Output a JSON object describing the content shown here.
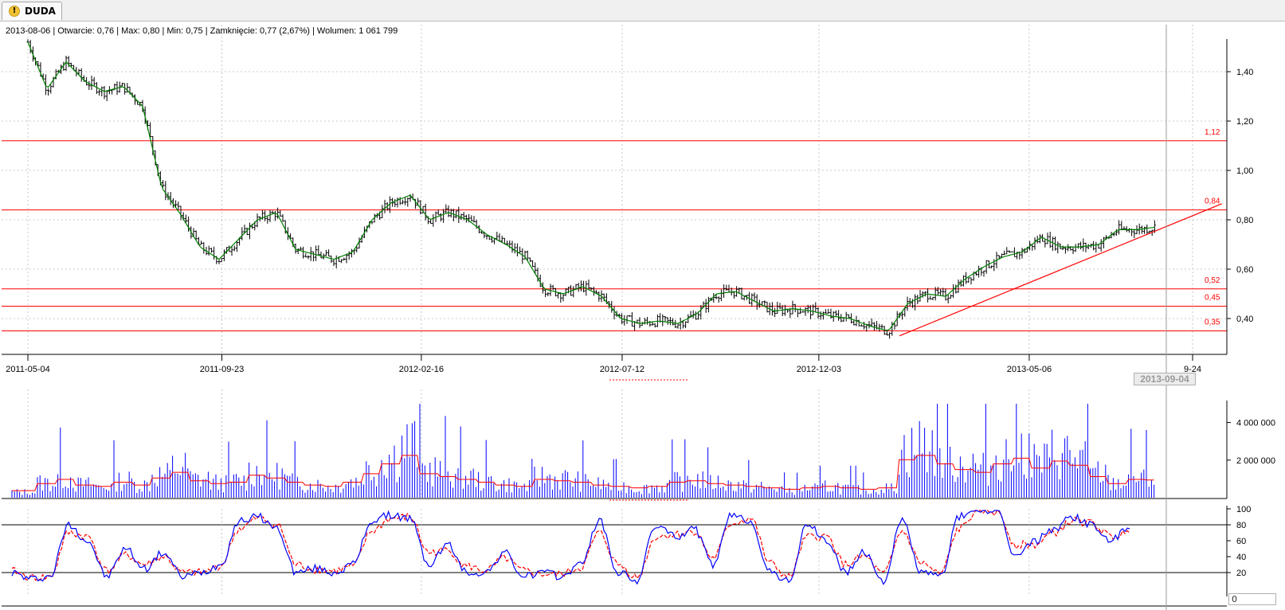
{
  "tab": {
    "label": "DUDA",
    "icon": "warning-icon"
  },
  "header": {
    "ohlc": "2013-08-06 | Otwarcie: 0,76 | Max: 0,80 | Min: 0,75 | Zamknięcie: 0,77 (2,67%) | Wolumen: 1 061 799"
  },
  "cursor_date": "2013-09-04",
  "corner_value": "0",
  "colors": {
    "bar": "#000000",
    "ma": "#008000",
    "level": "#ff0000",
    "volume": "#0000ff",
    "volume_ma": "#ff0000",
    "stoch_k": "#0000ff",
    "stoch_d": "#ff0000",
    "grid": "#c8c8c8"
  },
  "chart_data": [
    {
      "type": "line",
      "name": "price",
      "x_ticks": [
        "2011-05-04",
        "2011-09-23",
        "2012-02-16",
        "2012-07-12",
        "2012-12-03",
        "2013-05-06",
        "9-24"
      ],
      "y_ticks": [
        "1,40",
        "1,20",
        "1,00",
        "0,80",
        "0,60",
        "0,40"
      ],
      "ylim": [
        0.32,
        1.56
      ],
      "horizontal_levels": [
        {
          "value": 1.12,
          "label": "1,12"
        },
        {
          "value": 0.84,
          "label": "0,84"
        },
        {
          "value": 0.52,
          "label": "0,52"
        },
        {
          "value": 0.45,
          "label": "0,45"
        },
        {
          "value": 0.35,
          "label": "0,35"
        }
      ],
      "trendline": {
        "from": [
          "2013-01-31",
          0.33
        ],
        "to": [
          "2013-09-24",
          0.865
        ]
      },
      "x": [
        "2011-05-04",
        "2011-05-18",
        "2011-06-01",
        "2011-06-15",
        "2011-06-29",
        "2011-07-13",
        "2011-07-27",
        "2011-08-10",
        "2011-08-24",
        "2011-09-07",
        "2011-09-21",
        "2011-10-05",
        "2011-10-19",
        "2011-11-02",
        "2011-11-16",
        "2011-11-30",
        "2011-12-14",
        "2011-12-28",
        "2012-01-11",
        "2012-01-25",
        "2012-02-08",
        "2012-02-22",
        "2012-03-07",
        "2012-03-21",
        "2012-04-04",
        "2012-04-18",
        "2012-05-02",
        "2012-05-16",
        "2012-05-30",
        "2012-06-13",
        "2012-06-27",
        "2012-07-11",
        "2012-07-25",
        "2012-08-08",
        "2012-08-22",
        "2012-09-05",
        "2012-09-19",
        "2012-10-03",
        "2012-10-17",
        "2012-10-31",
        "2012-11-14",
        "2012-11-28",
        "2012-12-12",
        "2012-12-26",
        "2013-01-09",
        "2013-01-23",
        "2013-02-06",
        "2013-02-20",
        "2013-03-06",
        "2013-03-20",
        "2013-04-03",
        "2013-04-17",
        "2013-05-01",
        "2013-05-15",
        "2013-05-29",
        "2013-06-12",
        "2013-06-26",
        "2013-07-10",
        "2013-07-24",
        "2013-08-06"
      ],
      "close": [
        1.52,
        1.33,
        1.44,
        1.36,
        1.32,
        1.34,
        1.26,
        0.93,
        0.82,
        0.69,
        0.64,
        0.72,
        0.8,
        0.83,
        0.68,
        0.66,
        0.64,
        0.67,
        0.8,
        0.87,
        0.9,
        0.8,
        0.83,
        0.8,
        0.74,
        0.7,
        0.65,
        0.52,
        0.5,
        0.53,
        0.49,
        0.4,
        0.38,
        0.39,
        0.38,
        0.42,
        0.5,
        0.51,
        0.47,
        0.43,
        0.44,
        0.43,
        0.41,
        0.4,
        0.37,
        0.35,
        0.46,
        0.5,
        0.49,
        0.56,
        0.61,
        0.65,
        0.67,
        0.73,
        0.69,
        0.69,
        0.7,
        0.76,
        0.76,
        0.77
      ]
    },
    {
      "type": "bar",
      "name": "Wolumen",
      "y_ticks": [
        "4 000 000",
        "2 000 000"
      ],
      "ylim": [
        0,
        5000000
      ],
      "values": [
        300000,
        800000,
        1100000,
        700000,
        600000,
        900000,
        700000,
        1200000,
        1600000,
        1000000,
        800000,
        900000,
        1400000,
        1200000,
        900000,
        700000,
        600000,
        900000,
        1500000,
        2200000,
        2800000,
        1500000,
        1300000,
        1100000,
        900000,
        700000,
        600000,
        1100000,
        1000000,
        900000,
        700000,
        600000,
        500000,
        600000,
        900000,
        1000000,
        800000,
        700000,
        600000,
        500000,
        400000,
        500000,
        600000,
        500000,
        400000,
        500000,
        2500000,
        2800000,
        2200000,
        1800000,
        1600000,
        2200000,
        2600000,
        1900000,
        2400000,
        2100000,
        1300000,
        800000,
        1100000,
        1061799
      ]
    },
    {
      "type": "line",
      "name": "stochastic",
      "y_ticks": [
        "100",
        "80",
        "60",
        "40",
        "20"
      ],
      "ylim": [
        0,
        100
      ],
      "levels": [
        80,
        20
      ],
      "k": [
        20,
        12,
        15,
        80,
        60,
        15,
        50,
        25,
        45,
        15,
        20,
        30,
        85,
        90,
        75,
        20,
        25,
        20,
        30,
        85,
        92,
        88,
        30,
        55,
        20,
        20,
        45,
        15,
        20,
        15,
        30,
        85,
        20,
        10,
        80,
        65,
        75,
        30,
        92,
        85,
        20,
        10,
        80,
        60,
        20,
        45,
        10,
        85,
        20,
        15,
        90,
        100,
        95,
        40,
        60,
        75,
        90,
        80,
        60,
        75
      ],
      "d": [
        22,
        14,
        14,
        70,
        65,
        22,
        42,
        30,
        40,
        20,
        20,
        28,
        75,
        88,
        80,
        30,
        24,
        22,
        28,
        72,
        88,
        90,
        45,
        48,
        28,
        22,
        38,
        22,
        18,
        18,
        26,
        70,
        30,
        14,
        65,
        68,
        72,
        38,
        82,
        88,
        32,
        14,
        65,
        65,
        30,
        40,
        18,
        72,
        32,
        18,
        75,
        98,
        96,
        55,
        55,
        70,
        85,
        82,
        65,
        70
      ]
    }
  ]
}
